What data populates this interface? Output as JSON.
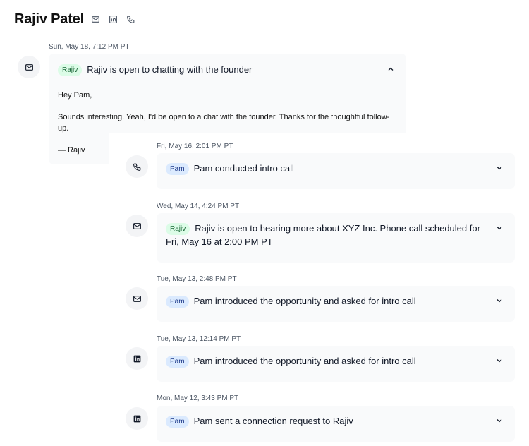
{
  "header": {
    "name": "Rajiv Patel",
    "icons": [
      "mail-icon",
      "linkedin-icon",
      "phone-icon"
    ]
  },
  "timeline": [
    {
      "timestamp": "Sun, May 18, 7:12 PM PT",
      "channel_icon": "mail-icon",
      "badge": "Rajiv",
      "title": "Rajiv is open to chatting with the founder",
      "expanded": true,
      "body": {
        "greeting": "Hey Pam,",
        "message": "Sounds interesting. Yeah, I'd be open to a chat with the founder. Thanks for the thoughtful follow-up.",
        "signoff": "— Rajiv"
      }
    },
    {
      "timestamp": "Fri, May 16, 2:01 PM PT",
      "channel_icon": "phone-icon",
      "badge": "Pam",
      "title": "Pam conducted intro call"
    },
    {
      "timestamp": "Wed, May 14, 4:24 PM PT",
      "channel_icon": "mail-icon",
      "badge": "Rajiv",
      "title": "Rajiv is open to hearing more about XYZ Inc. Phone call scheduled for Fri, May 16 at 2:00 PM PT"
    },
    {
      "timestamp": "Tue, May 13, 2:48 PM PT",
      "channel_icon": "mail-icon",
      "badge": "Pam",
      "title": "Pam introduced the opportunity and asked for intro call"
    },
    {
      "timestamp": "Tue, May 13, 12:14 PM PT",
      "channel_icon": "linkedin-icon",
      "badge": "Pam",
      "title": "Pam introduced the opportunity and asked for intro call"
    },
    {
      "timestamp": "Mon, May 12, 3:43 PM PT",
      "channel_icon": "linkedin-icon",
      "badge": "Pam",
      "title": "Pam sent a connection request to Rajiv"
    }
  ],
  "colors": {
    "badge_rajiv_bg": "#dcfce7",
    "badge_pam_bg": "#dbeafe",
    "card_bg": "#f9fafb"
  }
}
